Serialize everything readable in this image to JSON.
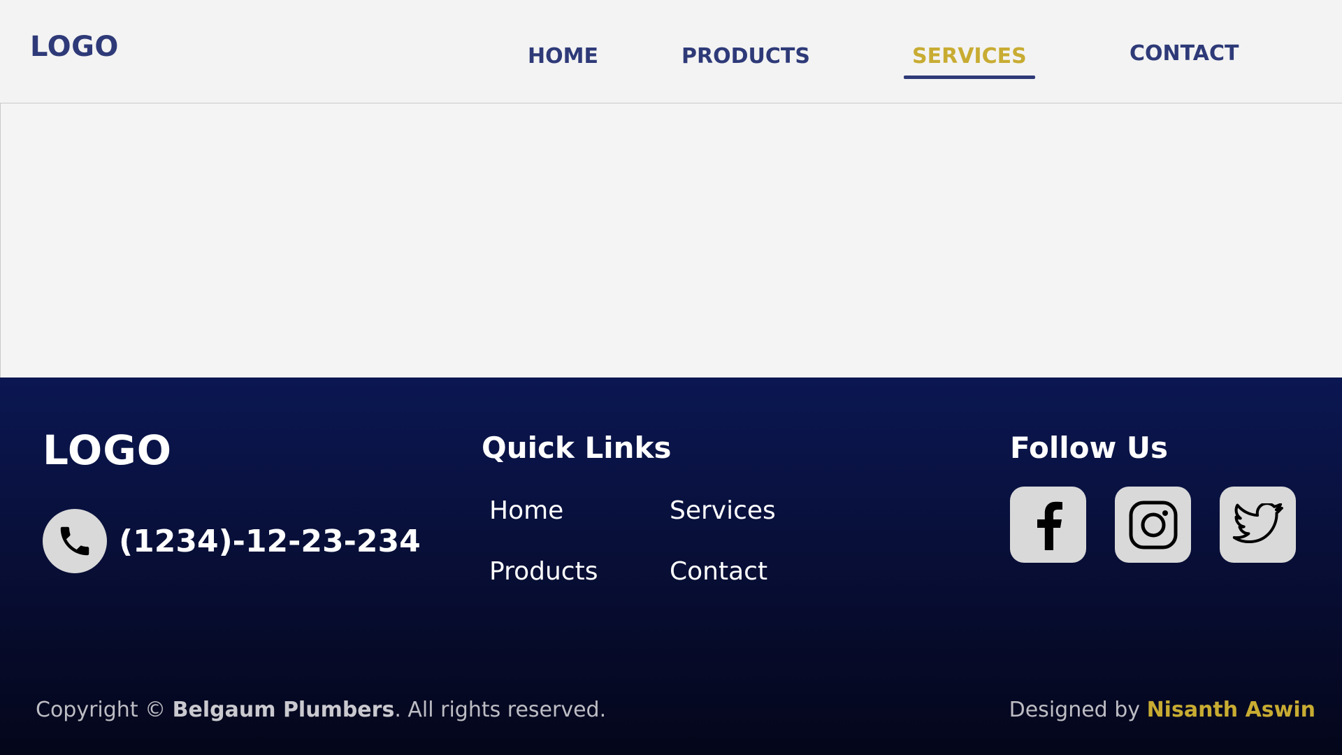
{
  "header": {
    "logo": "LOGO",
    "nav": [
      {
        "label": "HOME",
        "active": false
      },
      {
        "label": "PRODUCTS",
        "active": false
      },
      {
        "label": "SERVICES",
        "active": true
      },
      {
        "label": "CONTACT",
        "active": false
      }
    ]
  },
  "footer": {
    "logo": "LOGO",
    "phone": "(1234)-12-23-234",
    "phone_icon": "phone-icon",
    "quick_links": {
      "heading": "Quick Links",
      "links": [
        "Home",
        "Services",
        "Products",
        "Contact"
      ]
    },
    "follow_us": {
      "heading": "Follow Us",
      "icons": [
        "facebook-icon",
        "instagram-icon",
        "twitter-icon"
      ]
    },
    "copyright": {
      "prefix": "Copyright © ",
      "brand": "Belgaum Plumbers",
      "suffix": ". All rights reserved."
    },
    "credit": {
      "prefix": "Designed by ",
      "designer": "Nisanth Aswin"
    }
  },
  "colors": {
    "primary": "#2e3a78",
    "accent": "#c8ac32",
    "footer_bg_top": "#0b1752",
    "footer_bg_bottom": "#04061a",
    "page_bg": "#f3f3f3"
  }
}
